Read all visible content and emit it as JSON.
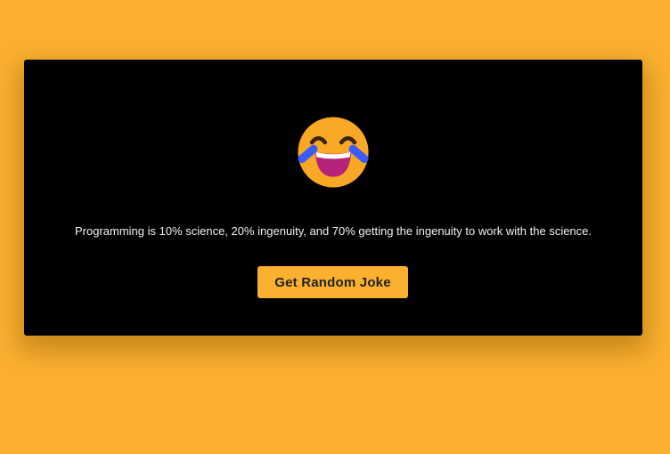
{
  "joke_card": {
    "emoji_icon": "laughing-with-tears-face",
    "joke_text": "Programming is 10% science, 20% ingenuity, and 70% getting the ingenuity to work with the science.",
    "button_label": "Get Random Joke"
  },
  "colors": {
    "background": "#fbb030",
    "card": "#000000",
    "button": "#fbb030",
    "button_text": "#222222",
    "joke_text": "#f2f2f2"
  }
}
